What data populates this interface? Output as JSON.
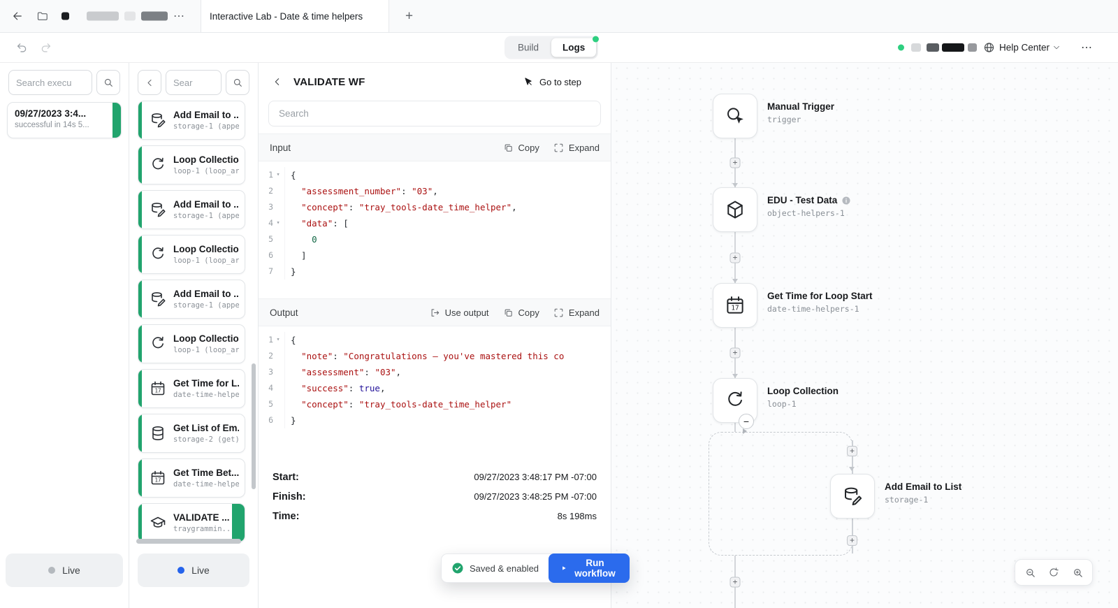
{
  "colors": {
    "green": "#21a46d",
    "green-bright": "#2ecf80",
    "blue": "#2b6bed",
    "blue-dot": "#2563eb"
  },
  "tab": {
    "title": "Interactive Lab - Date & time helpers"
  },
  "toolbar": {
    "build": "Build",
    "logs": "Logs",
    "help": "Help Center"
  },
  "executions_panel": {
    "search_placeholder": "Search execu",
    "execution": {
      "title": "09/27/2023 3:4...",
      "subtitle": "successful in 14s 5..."
    },
    "live_label": "Live"
  },
  "steps_panel": {
    "search_placeholder": "Sear",
    "live_label": "Live",
    "items": [
      {
        "title": "Add Email to ...",
        "subtitle": "storage-1 (appe...",
        "icon": "database-edit-icon"
      },
      {
        "title": "Loop Collection",
        "subtitle": "loop-1 (loop_arr...",
        "icon": "loop-icon"
      },
      {
        "title": "Add Email to ...",
        "subtitle": "storage-1 (appe...",
        "icon": "database-edit-icon"
      },
      {
        "title": "Loop Collection",
        "subtitle": "loop-1 (loop_arr...",
        "icon": "loop-icon"
      },
      {
        "title": "Add Email to ...",
        "subtitle": "storage-1 (appe...",
        "icon": "database-edit-icon"
      },
      {
        "title": "Loop Collection",
        "subtitle": "loop-1 (loop_arr...",
        "icon": "loop-icon"
      },
      {
        "title": "Get Time for L...",
        "subtitle": "date-time-helper...",
        "icon": "calendar-icon"
      },
      {
        "title": "Get List of Em...",
        "subtitle": "storage-2 (get)",
        "icon": "database-icon"
      },
      {
        "title": "Get Time Bet...",
        "subtitle": "date-time-helper...",
        "icon": "calendar-icon"
      },
      {
        "title": "VALIDATE ...",
        "subtitle": "traygrammin...",
        "icon": "graduation-cap-icon",
        "selected": true
      }
    ]
  },
  "detail_panel": {
    "title": "VALIDATE WF",
    "go_to_step": "Go to step",
    "search_placeholder": "Search",
    "input": {
      "label": "Input",
      "copy_label": "Copy",
      "expand_label": "Expand",
      "lines": [
        {
          "n": 1,
          "f": true,
          "t": [
            [
              "p",
              "{"
            ]
          ]
        },
        {
          "n": 2,
          "t": [
            [
              "p",
              "  "
            ],
            [
              "s",
              "\"assessment_number\""
            ],
            [
              "p",
              ": "
            ],
            [
              "s",
              "\"03\""
            ],
            [
              "p",
              ","
            ]
          ]
        },
        {
          "n": 3,
          "t": [
            [
              "p",
              "  "
            ],
            [
              "s",
              "\"concept\""
            ],
            [
              "p",
              ": "
            ],
            [
              "s",
              "\"tray_tools-date_time_helper\""
            ],
            [
              "p",
              ","
            ]
          ]
        },
        {
          "n": 4,
          "f": true,
          "t": [
            [
              "p",
              "  "
            ],
            [
              "s",
              "\"data\""
            ],
            [
              "p",
              ": ["
            ]
          ]
        },
        {
          "n": 5,
          "t": [
            [
              "p",
              "    "
            ],
            [
              "n",
              "0"
            ]
          ]
        },
        {
          "n": 6,
          "t": [
            [
              "p",
              "  ]"
            ]
          ]
        },
        {
          "n": 7,
          "t": [
            [
              "p",
              "}"
            ]
          ]
        }
      ]
    },
    "output": {
      "label": "Output",
      "use_output_label": "Use output",
      "copy_label": "Copy",
      "expand_label": "Expand",
      "lines": [
        {
          "n": 1,
          "f": true,
          "t": [
            [
              "p",
              "{"
            ]
          ]
        },
        {
          "n": 2,
          "t": [
            [
              "p",
              "  "
            ],
            [
              "s",
              "\"note\""
            ],
            [
              "p",
              ": "
            ],
            [
              "s",
              "\"Congratulations — you've mastered this co"
            ]
          ]
        },
        {
          "n": 3,
          "t": [
            [
              "p",
              "  "
            ],
            [
              "s",
              "\"assessment\""
            ],
            [
              "p",
              ": "
            ],
            [
              "s",
              "\"03\""
            ],
            [
              "p",
              ","
            ]
          ]
        },
        {
          "n": 4,
          "t": [
            [
              "p",
              "  "
            ],
            [
              "s",
              "\"success\""
            ],
            [
              "p",
              ": "
            ],
            [
              "a",
              "true"
            ],
            [
              "p",
              ","
            ]
          ]
        },
        {
          "n": 5,
          "t": [
            [
              "p",
              "  "
            ],
            [
              "s",
              "\"concept\""
            ],
            [
              "p",
              ": "
            ],
            [
              "s",
              "\"tray_tools-date_time_helper\""
            ]
          ]
        },
        {
          "n": 6,
          "t": [
            [
              "p",
              "}"
            ]
          ]
        }
      ]
    },
    "meta": {
      "start_label": "Start:",
      "start_value": "09/27/2023 3:48:17 PM -07:00",
      "finish_label": "Finish:",
      "finish_value": "09/27/2023 3:48:25 PM -07:00",
      "time_label": "Time:",
      "time_value": "8s 198ms"
    },
    "saved_label": "Saved & enabled",
    "run_label": "Run workflow"
  },
  "canvas": {
    "nodes": [
      {
        "title": "Manual Trigger",
        "subtitle": "trigger",
        "icon": "manual-trigger-icon"
      },
      {
        "title": "EDU - Test Data",
        "subtitle": "object-helpers-1",
        "icon": "cube-icon",
        "has_info": true
      },
      {
        "title": "Get Time for Loop Start",
        "subtitle": "date-time-helpers-1",
        "icon": "calendar-icon"
      },
      {
        "title": "Loop Collection",
        "subtitle": "loop-1",
        "icon": "loop-icon"
      },
      {
        "title": "Add Email to List",
        "subtitle": "storage-1",
        "icon": "database-edit-icon"
      }
    ]
  }
}
